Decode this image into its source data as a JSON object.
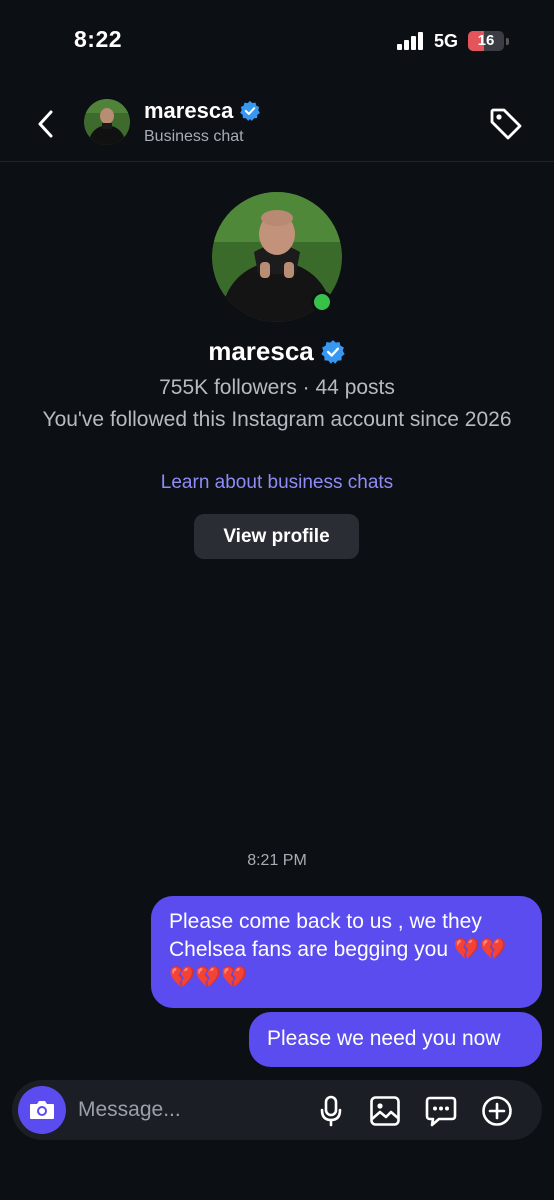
{
  "status_bar": {
    "time": "8:22",
    "network": "5G",
    "battery": "16",
    "battery_level": 0.16
  },
  "header": {
    "name": "maresca",
    "subtitle": "Business chat",
    "icons": [
      "back-chevron-icon",
      "verified-badge-icon",
      "tag-icon"
    ]
  },
  "profile": {
    "name": "maresca",
    "stats": "755K followers · 44 posts",
    "since": "You've followed this Instagram account since 2026",
    "learn_link": "Learn about business chats",
    "view_profile_label": "View profile"
  },
  "messages": {
    "timestamp": "8:21 PM",
    "items": [
      {
        "sender": "me",
        "text": "Please come back to us , we they Chelsea fans are begging you 💔💔💔💔💔"
      },
      {
        "sender": "me",
        "text": "Please we need you now"
      }
    ]
  },
  "composer": {
    "placeholder": "Message...",
    "icons": [
      "camera-icon",
      "microphone-icon",
      "gallery-icon",
      "chat-more-icon",
      "add-icon"
    ]
  },
  "colors": {
    "background": "#0c0f14",
    "bubble": "#5b4cf0",
    "link": "#8f8cf6",
    "verified": "#3897f0",
    "online": "#37c14a",
    "battery": "#e3545b"
  }
}
